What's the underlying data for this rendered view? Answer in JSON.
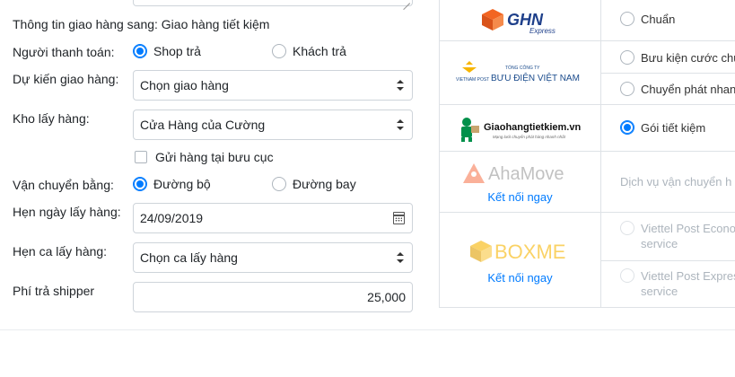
{
  "shipping": {
    "info_label": "Thông tin giao hàng sang: Giao hàng tiết kiệm",
    "payer_label": "Người thanh toán:",
    "payer_options": [
      "Shop trả",
      "Khách trả"
    ],
    "expected_label": "Dự kiến giao hàng:",
    "expected_value": "Chọn giao hàng",
    "warehouse_label": "Kho lấy hàng:",
    "warehouse_value": "Cửa Hàng của Cường",
    "post_office_label": "Gửi hàng tại bưu cục",
    "transport_label": "Vận chuyển bằng:",
    "transport_options": [
      "Đường bộ",
      "Đường bay"
    ],
    "pickup_date_label": "Hẹn ngày lấy hàng:",
    "pickup_date_value": "24/09/2019",
    "pickup_shift_label": "Hẹn ca lấy hàng:",
    "pickup_shift_value": "Chọn ca lấy hàng",
    "shipper_fee_label": "Phí trả shipper",
    "shipper_fee_value": "25,000"
  },
  "carriers": {
    "ghn": {
      "logo": "GHN",
      "logo_sub": "Express",
      "options": [
        "Chuẩn"
      ]
    },
    "vnpost": {
      "logo_small": "TỔNG CÔNG TY",
      "logo": "BƯU ĐIỆN VIỆT NAM",
      "logo_left": "VIETNAM POST",
      "options": [
        "Bưu kiện cước chu",
        "Chuyển phát nhan"
      ]
    },
    "ghtk": {
      "logo": "Giaohangtietkiem.vn",
      "logo_sub": "Mạng lưới chuyển phát hàng nhanh nhất",
      "options": [
        "Gói tiết kiệm"
      ]
    },
    "ahamove": {
      "logo": "AhaMove",
      "connect": "Kết nối ngay",
      "note": "Dịch vụ vận chuyển h"
    },
    "boxme": {
      "logo": "BOXME",
      "connect": "Kết nối ngay",
      "options": [
        "Viettel Post Econo",
        "service",
        "Viettel Post Expres",
        "service"
      ]
    }
  },
  "colors": {
    "accent": "#007bff",
    "ghn_orange": "#f26522",
    "ghn_blue": "#1e3f8a",
    "ghtk_green": "#00904a",
    "aha_orange": "#f4511e",
    "boxme_yellow": "#f7b500"
  }
}
